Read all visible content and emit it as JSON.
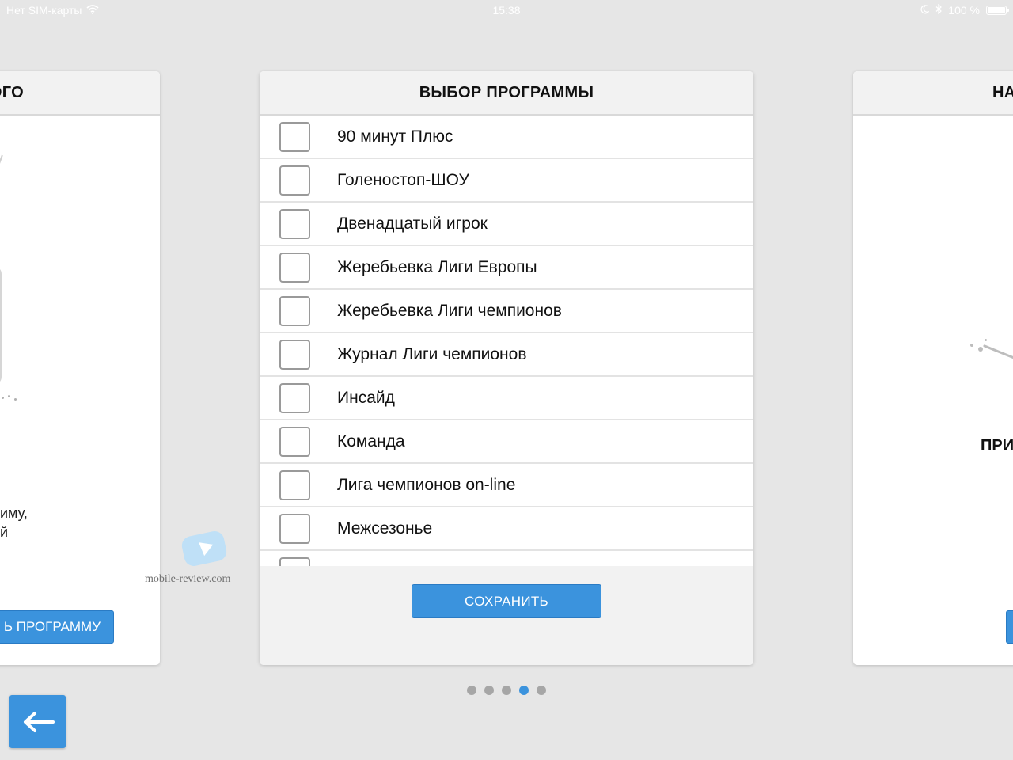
{
  "status_bar": {
    "carrier": "Нет SIM-карты",
    "time": "15:38",
    "battery_percent": "100 %"
  },
  "left_card": {
    "title_fragment": "ОГО",
    "text_line1": "иму,",
    "text_line2": "й",
    "button_label": "Ь ПРОГРАММУ"
  },
  "main_card": {
    "title": "ВЫБОР ПРОГРАММЫ",
    "items": [
      {
        "label": "90 минут Плюс",
        "checked": false
      },
      {
        "label": "Голеностоп-ШОУ",
        "checked": false
      },
      {
        "label": "Двенадцатый игрок",
        "checked": false
      },
      {
        "label": "Жеребьевка Лиги Европы",
        "checked": false
      },
      {
        "label": "Жеребьевка Лиги чемпионов",
        "checked": false
      },
      {
        "label": "Журнал Лиги чемпионов",
        "checked": false
      },
      {
        "label": "Инсайд",
        "checked": false
      },
      {
        "label": "Команда",
        "checked": false
      },
      {
        "label": "Лига чемпионов on-line",
        "checked": false
      },
      {
        "label": "Межсезонье",
        "checked": false
      },
      {
        "label": "",
        "checked": false
      }
    ],
    "save_label": "СОХРАНИТЬ"
  },
  "right_card": {
    "title_fragment": "НА",
    "heading_fragment": "ПРИ"
  },
  "watermark": {
    "text": "mobile-review.com"
  },
  "pagination": {
    "total": 5,
    "active_index": 3
  },
  "colors": {
    "accent": "#3b93dd",
    "background": "#e6e6e6",
    "header_bg": "#f2f2f2"
  }
}
